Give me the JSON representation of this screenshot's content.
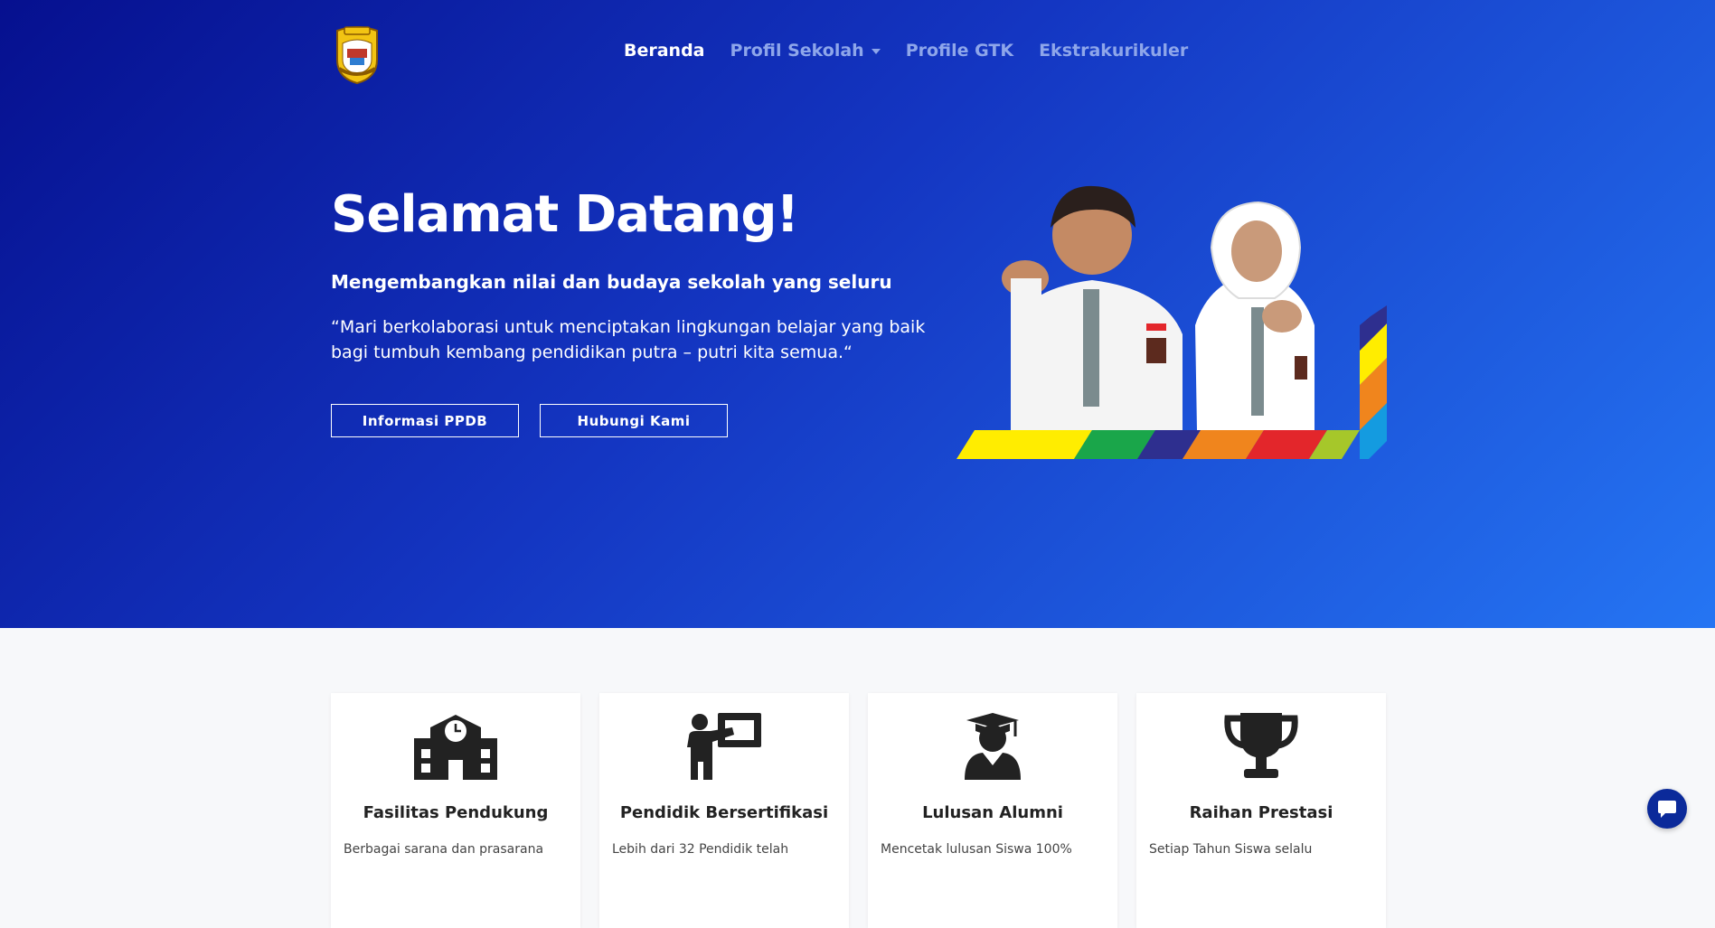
{
  "brand": {
    "logo_icon": "city-emblem-icon"
  },
  "nav": {
    "items": [
      {
        "label": "Beranda",
        "active": true
      },
      {
        "label": "Profil Sekolah",
        "dropdown": true
      },
      {
        "label": "Profile GTK"
      },
      {
        "label": "Ekstrakurikuler"
      }
    ]
  },
  "hero": {
    "title": "Selamat Datang!",
    "subtitle": "Mengembangkan nilai dan budaya sekolah yang seluru",
    "quote": "“Mari berkolaborasi untuk menciptakan lingkungan belajar yang baik bagi tumbuh kembang pendidikan putra – putri kita semua.“",
    "buttons": {
      "ppdb": "Informasi PPDB",
      "contact": "Hubungi Kami"
    },
    "image": "students-illustration"
  },
  "features": [
    {
      "icon": "school-icon",
      "title": "Fasilitas Pendukung",
      "desc": "Berbagai sarana dan prasarana"
    },
    {
      "icon": "teacher-icon",
      "title": "Pendidik Bersertifikasi",
      "desc": "Lebih dari 32 Pendidik telah"
    },
    {
      "icon": "graduate-icon",
      "title": "Lulusan Alumni",
      "desc": "Mencetak lulusan Siswa 100%"
    },
    {
      "icon": "trophy-icon",
      "title": "Raihan Prestasi",
      "desc": "Setiap Tahun Siswa selalu"
    }
  ],
  "chat": {
    "icon": "chat-bubble-icon"
  },
  "colors": {
    "hero_start": "#06108f",
    "hero_end": "#2575f3",
    "nav_inactive": "#8ea6ea"
  }
}
